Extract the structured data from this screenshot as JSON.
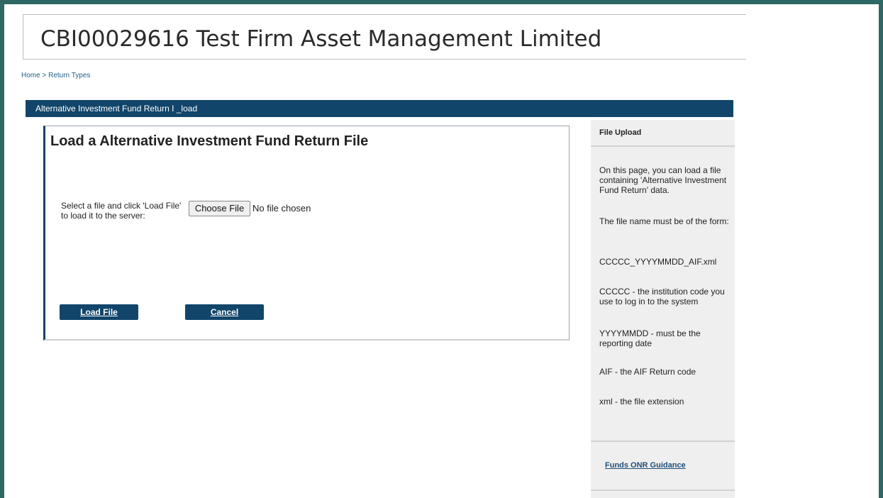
{
  "header": {
    "title": "CBI00029616 Test Firm Asset Management Limited"
  },
  "breadcrumb": {
    "home": "Home",
    "separator": ">",
    "current": "Return Types"
  },
  "title_bar": {
    "text": "Alternative Investment Fund Return I _load"
  },
  "main": {
    "heading": "Load a Alternative Investment Fund Return File",
    "select_label": "Select a file and click 'Load File' to load it to the server:",
    "choose_file_label": "Choose File",
    "no_file_text": "No file chosen",
    "load_button": "Load File",
    "cancel_button": "Cancel"
  },
  "sidebar": {
    "title": "File Upload",
    "paragraphs": [
      "On this page, you can load a file containing 'Alternative Investment Fund Return' data.",
      "The file name must be of the form:",
      "CCCCC_YYYYMMDD_AIF.xml",
      "CCCCC - the institution code you use to log in to the system",
      "YYYYMMDD - must be the reporting date",
      "AIF - the AIF Return code",
      "xml - the file extension"
    ],
    "link": "Funds ONR Guidance"
  },
  "colors": {
    "frame": "#2d6864",
    "navy": "#11456a",
    "sidebar_bg": "#efefef"
  }
}
